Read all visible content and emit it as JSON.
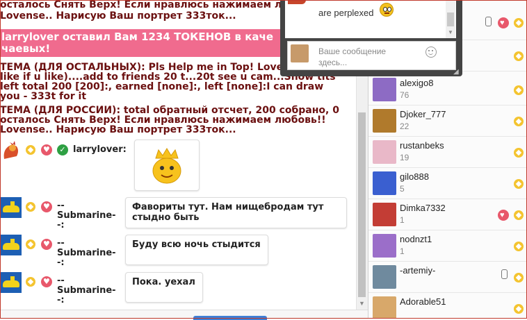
{
  "chat": {
    "topic_line1": "осталось Снять Верх! Если нравлюсь нажимаем лю",
    "topic_line2": "Lovense.. Нарисую Ваш портрет 333ток...",
    "tip_banner_line1": "larrylover оставил Вам 1234 ТОКЕНОВ в каче",
    "tip_banner_line2": "чаевых!",
    "others_topic": [
      "ТЕМА (ДЛЯ ОСТАЛЬНЫХ): Pls Help me in Top! Love",
      "like if u like)....add to friends 20 t...20t see u cam...Show tits",
      "left total 200 [200]:, earned [none]:, left [none]:I can draw",
      "you - 333t for it"
    ],
    "russia_topic": [
      "ТЕМА (ДЛЯ РОССИИ): total обратный отсчет, 200 собрано, 0",
      "осталось Снять Верх! Если нравлюсь нажимаем любовь!!",
      "Lovense.. Нарисую Ваш портрет 333ток..."
    ],
    "messages": [
      {
        "nick": "larrylover:"
      },
      {
        "nick_lines": [
          "--",
          "Submarine-",
          "-:"
        ],
        "text": "Фавориты тут. Нам нищебродам тут стыдно быть"
      },
      {
        "nick_lines": [
          "--",
          "Submarine-",
          "-:"
        ],
        "text": "Буду всю ночь стыдится"
      },
      {
        "nick_lines": [
          "--",
          "Submarine-",
          "-:"
        ],
        "text": "Пока. уехал"
      }
    ]
  },
  "popup": {
    "last_message": "are perplexed",
    "input_placeholder": "Ваше сообщение здесь..."
  },
  "users": [
    {
      "name": "alexigo8",
      "count": "76",
      "avatar_color": "#8d6bc4"
    },
    {
      "name": "Djoker_777",
      "count": "22",
      "avatar_color": "#b07a2c"
    },
    {
      "name": "rustanbeks",
      "count": "19",
      "avatar_color": "#e9b8c8"
    },
    {
      "name": "gilo888",
      "count": "5",
      "avatar_color": "#3a5fd0"
    },
    {
      "name": "Dimka7332",
      "count": "1",
      "avatar_color": "#c33d35"
    },
    {
      "name": "nodnzt1",
      "count": "1",
      "avatar_color": "#9b6ec9"
    },
    {
      "name": "-artemiy-",
      "count": "",
      "avatar_color": "#6f8a9e"
    },
    {
      "name": "Adorable51",
      "count": "",
      "avatar_color": "#d8a86a"
    }
  ],
  "colors": {
    "coin": "#f4c430",
    "heart": "#e8586b",
    "banner": "#f06b8e",
    "topic_text": "#6b1010"
  }
}
